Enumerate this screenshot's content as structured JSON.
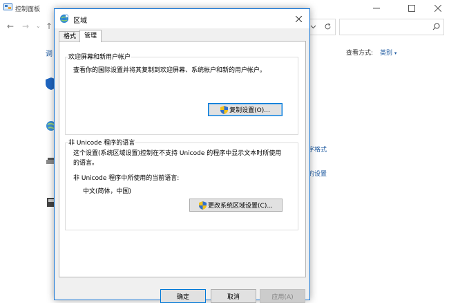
{
  "background_window": {
    "title": "控制面板",
    "side_heading": "调",
    "view_label": "查看方式:",
    "view_value": "类别",
    "links": [
      "字格式",
      "的设置"
    ]
  },
  "dialog": {
    "title": "区域",
    "tabs": [
      {
        "label": "格式",
        "active": false
      },
      {
        "label": "管理",
        "active": true
      }
    ],
    "welcome_group": {
      "title": "欢迎屏幕和新用户帐户",
      "description": "查看你的国际设置并将其复制到欢迎屏幕、系统帐户和新的用户帐户。",
      "button_label": "复制设置(O)..."
    },
    "unicode_group": {
      "title": "非 Unicode 程序的语言",
      "description_line1": "这个设置(系统区域设置)控制在不支持 Unicode 的程序中显示文本时所使用",
      "description_line2": "的语言。",
      "current_label": "非 Unicode 程序中所使用的当前语言:",
      "current_value": "中文(简体，中国)",
      "button_label": "更改系统区域设置(C)..."
    },
    "buttons": {
      "ok": "确定",
      "cancel": "取消",
      "apply": "应用(A)"
    }
  },
  "colors": {
    "accent": "#0078d7",
    "link": "#1e5aa0",
    "dialog_border": "#1a78d6"
  }
}
